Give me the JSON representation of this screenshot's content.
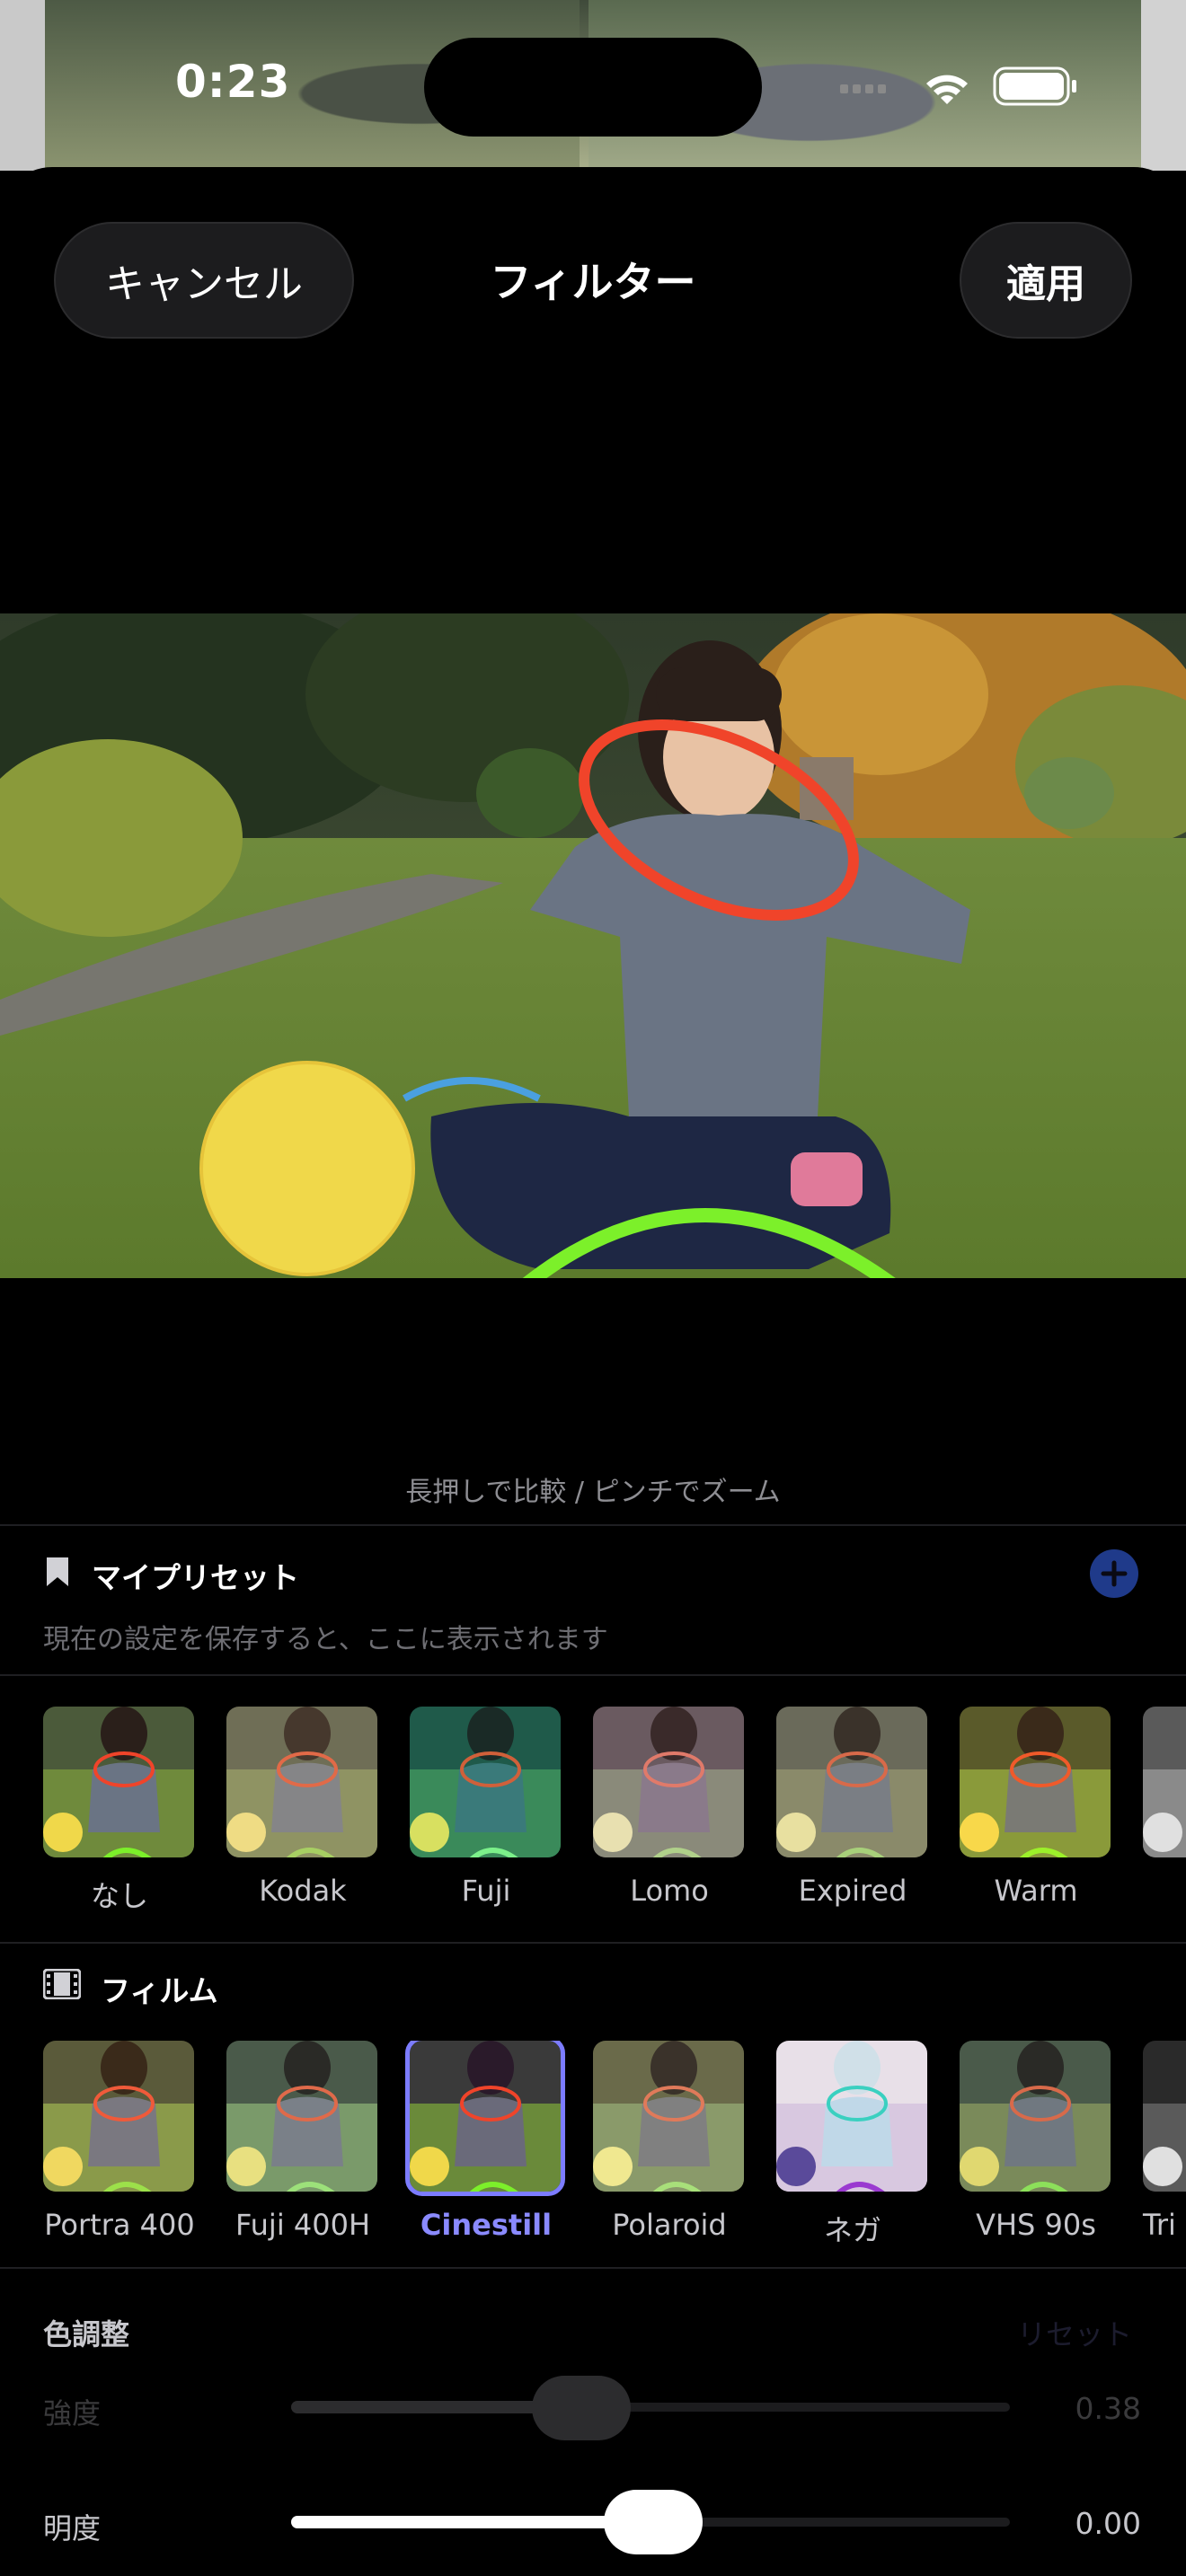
{
  "status": {
    "time": "0:23"
  },
  "header": {
    "cancel_label": "キャンセル",
    "title": "フィルター",
    "apply_label": "適用"
  },
  "preview": {
    "hint": "長押しで比較 / ピンチでズーム"
  },
  "presets": {
    "title": "マイプリセット",
    "empty_text": "現在の設定を保存すると、ここに表示されます"
  },
  "basic_filters": [
    {
      "label": "なし",
      "tint": "none"
    },
    {
      "label": "Kodak",
      "tint": "#e8c79a"
    },
    {
      "label": "Fuji",
      "tint": "#2fa58f"
    },
    {
      "label": "Lomo",
      "tint": "#d7b0c8"
    },
    {
      "label": "Expired",
      "tint": "#cfc5a8"
    },
    {
      "label": "Warm",
      "tint": "#f0b860"
    }
  ],
  "film": {
    "title": "フィルム",
    "items": [
      {
        "label": "Portra 400",
        "tint": "#e8b98a",
        "selected": false
      },
      {
        "label": "Fuji 400H",
        "tint": "#a6c7b8",
        "selected": false
      },
      {
        "label": "Cinestill",
        "tint": "#9f7fb8",
        "selected": true
      },
      {
        "label": "Polaroid",
        "tint": "#d8cfa8",
        "selected": false
      },
      {
        "label": "ネガ",
        "tint": "invert",
        "selected": false
      },
      {
        "label": "VHS 90s",
        "tint": "#9fb6a0",
        "selected": false
      },
      {
        "label": "Tri",
        "tint": "gray",
        "selected": false
      }
    ]
  },
  "adjust": {
    "title": "色調整",
    "reset_label": "リセット",
    "sliders": [
      {
        "label": "強度",
        "value": "0.38",
        "fraction": 0.38
      },
      {
        "label": "明度",
        "value": "0.00",
        "fraction": 0.5
      }
    ]
  },
  "colors": {
    "accent": "#7c7cff",
    "add_button": "#1f3a8a"
  }
}
